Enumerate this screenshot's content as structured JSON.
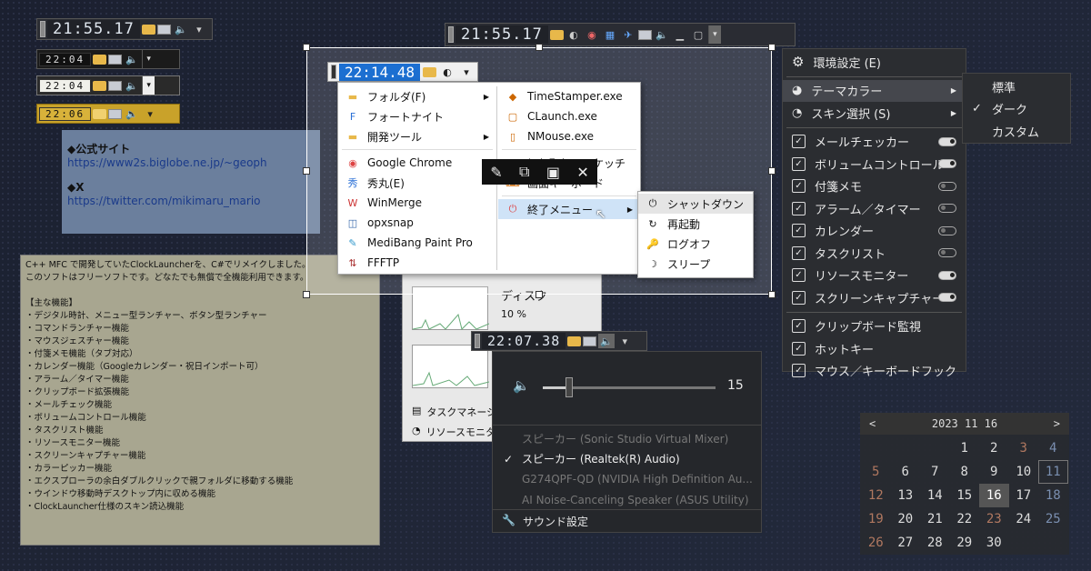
{
  "clocks": {
    "big1": "21:55.17",
    "mini1": "22:04",
    "mini2": "22:04",
    "mini3": "22:06",
    "taskbar": "21:55.17",
    "main": "22:14.48",
    "sound": "22:07.38"
  },
  "note_top": {
    "h1": "◆公式サイト",
    "l1": "https://www2s.biglobe.ne.jp/~geoph",
    "h2": "◆X",
    "l2": "https://twitter.com/mikimaru_mario"
  },
  "note_bottom": [
    "C++ MFC で開発していたClockLauncherを、C#でリメイクしました。",
    "このソフトはフリーソフトです。どなたでも無償で全機能利用できます。",
    "",
    "【主な機能】",
    "・デジタル時計、メニュー型ランチャー、ボタン型ランチャー",
    "・コマンドランチャー機能",
    "・マウスジェスチャー機能",
    "・付箋メモ機能（タブ対応）",
    "・カレンダー機能（Googleカレンダー・祝日インポート可）",
    "・アラーム／タイマー機能",
    "・クリップボード拡張機能",
    "・メールチェック機能",
    "・ボリュームコントロール機能",
    "・タスクリスト機能",
    "・リソースモニター機能",
    "・スクリーンキャプチャー機能",
    "・カラーピッカー機能",
    "・エクスプローラの余白ダブルクリックで親フォルダに移動する機能",
    "・ウインドウ移動時デスクトップ内に収める機能",
    "・ClockLauncher仕様のスキン読込機能"
  ],
  "launcher_left": [
    {
      "label": "フォルダ(F)",
      "icon": "folder-icon",
      "sub": true
    },
    {
      "label": "フォートナイト",
      "icon": "fortnite-icon",
      "sub": false
    },
    {
      "label": "開発ツール",
      "icon": "folder-icon",
      "sub": true
    },
    {
      "label": "Google Chrome",
      "icon": "chrome-icon",
      "sub": false
    },
    {
      "label": "秀丸(E)",
      "icon": "hidemaru-icon",
      "sub": false
    },
    {
      "label": "WinMerge",
      "icon": "winmerge-icon",
      "sub": false
    },
    {
      "label": "opxsnap",
      "icon": "opxsnap-icon",
      "sub": false
    },
    {
      "label": "MediBang Paint Pro",
      "icon": "medibang-icon",
      "sub": false
    },
    {
      "label": "FFFTP",
      "icon": "ffftp-icon",
      "sub": false
    }
  ],
  "launcher_right": [
    {
      "label": "TimeStamper.exe"
    },
    {
      "label": "CLaunch.exe"
    },
    {
      "label": "NMouse.exe"
    },
    {
      "label": "切り取り＆スケッチ"
    },
    {
      "label": "画面キーボード"
    },
    {
      "label": "終了メニュー"
    }
  ],
  "shutdown_menu": [
    "シャットダウン",
    "再起動",
    "ログオフ",
    "スリープ"
  ],
  "settings_menu": {
    "env": "環境設定 (E)",
    "theme": "テーマカラー",
    "skin": "スキン選択 (S)",
    "features": [
      {
        "label": "メールチェッカー",
        "toggle": "on"
      },
      {
        "label": "ボリュームコントロール",
        "toggle": "on"
      },
      {
        "label": "付箋メモ",
        "toggle": "off"
      },
      {
        "label": "アラーム／タイマー",
        "toggle": "off"
      },
      {
        "label": "カレンダー",
        "toggle": "off"
      },
      {
        "label": "タスクリスト",
        "toggle": "off"
      },
      {
        "label": "リソースモニター",
        "toggle": "on"
      },
      {
        "label": "スクリーンキャプチャー",
        "toggle": "on"
      }
    ],
    "extras": [
      "クリップボード監視",
      "ホットキー",
      "マウス／キーボードフック"
    ]
  },
  "theme_submenu": {
    "items": [
      "標準",
      "ダーク",
      "カスタム"
    ],
    "selected": "ダーク"
  },
  "resource": {
    "disk_label": "ディスク",
    "disk_value": "10 %",
    "task_manager": "タスクマネージ",
    "resource_monitor": "リソースモニター"
  },
  "sound": {
    "volume": "15",
    "volume_level": 0.15,
    "devices": [
      {
        "label": "スピーカー (Sonic Studio Virtual Mixer)",
        "active": false
      },
      {
        "label": "スピーカー (Realtek(R) Audio)",
        "active": true
      },
      {
        "label": "G274QPF-QD (NVIDIA High Definition Au...",
        "active": false
      },
      {
        "label": "AI Noise-Canceling Speaker (ASUS Utility)",
        "active": false
      }
    ],
    "settings": "サウンド設定"
  },
  "calendar": {
    "title": "2023 11 16",
    "prev": "<",
    "next": ">",
    "rows": [
      [
        "",
        "",
        "",
        "1",
        "2",
        "3",
        "4"
      ],
      [
        "5",
        "6",
        "7",
        "8",
        "9",
        "10",
        "11"
      ],
      [
        "12",
        "13",
        "14",
        "15",
        "16",
        "17",
        "18"
      ],
      [
        "19",
        "20",
        "21",
        "22",
        "23",
        "24",
        "25"
      ],
      [
        "26",
        "27",
        "28",
        "29",
        "30",
        "",
        ""
      ]
    ],
    "today": "16"
  }
}
